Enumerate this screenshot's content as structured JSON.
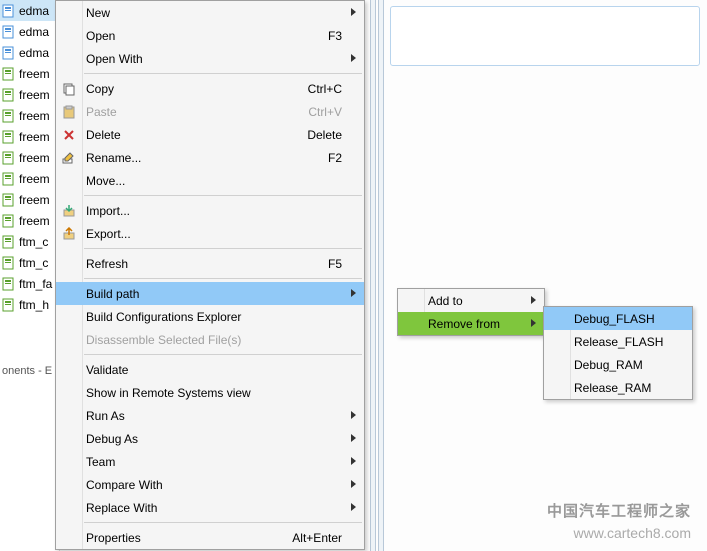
{
  "tree": {
    "items": [
      {
        "label": "edma",
        "icon": "file-blue",
        "selected": true
      },
      {
        "label": "edma",
        "icon": "file-blue"
      },
      {
        "label": "edma",
        "icon": "file-blue"
      },
      {
        "label": "freem",
        "icon": "file-green"
      },
      {
        "label": "freem",
        "icon": "file-green"
      },
      {
        "label": "freem",
        "icon": "file-green"
      },
      {
        "label": "freem",
        "icon": "file-green"
      },
      {
        "label": "freem",
        "icon": "file-green"
      },
      {
        "label": "freem",
        "icon": "file-green"
      },
      {
        "label": "freem",
        "icon": "file-green"
      },
      {
        "label": "freem",
        "icon": "file-green"
      },
      {
        "label": "ftm_c",
        "icon": "file-green"
      },
      {
        "label": "ftm_c",
        "icon": "file-green"
      },
      {
        "label": "ftm_fa",
        "icon": "file-green"
      },
      {
        "label": "ftm_h",
        "icon": "file-green"
      }
    ]
  },
  "bottom_panel": "onents - E",
  "menu1": {
    "groups": [
      [
        {
          "label": "New",
          "submenu": true
        },
        {
          "label": "Open",
          "shortcut": "F3"
        },
        {
          "label": "Open With",
          "submenu": true
        }
      ],
      [
        {
          "label": "Copy",
          "shortcut": "Ctrl+C",
          "icon": "copy"
        },
        {
          "label": "Paste",
          "shortcut": "Ctrl+V",
          "icon": "paste",
          "disabled": true
        },
        {
          "label": "Delete",
          "shortcut": "Delete",
          "icon": "delete"
        },
        {
          "label": "Rename...",
          "shortcut": "F2",
          "icon": "rename"
        },
        {
          "label": "Move..."
        }
      ],
      [
        {
          "label": "Import...",
          "icon": "import"
        },
        {
          "label": "Export...",
          "icon": "export"
        }
      ],
      [
        {
          "label": "Refresh",
          "shortcut": "F5"
        }
      ],
      [
        {
          "label": "Build path",
          "submenu": true,
          "hover": true
        },
        {
          "label": "Build Configurations Explorer"
        },
        {
          "label": "Disassemble Selected File(s)",
          "disabled": true
        }
      ],
      [
        {
          "label": "Validate"
        },
        {
          "label": "Show in Remote Systems view"
        },
        {
          "label": "Run As",
          "submenu": true
        },
        {
          "label": "Debug As",
          "submenu": true
        },
        {
          "label": "Team",
          "submenu": true
        },
        {
          "label": "Compare With",
          "submenu": true
        },
        {
          "label": "Replace With",
          "submenu": true
        }
      ],
      [
        {
          "label": "Properties",
          "shortcut": "Alt+Enter"
        }
      ]
    ]
  },
  "menu2": {
    "items": [
      {
        "label": "Add to",
        "submenu": true
      },
      {
        "label": "Remove from",
        "submenu": true,
        "hover": true
      }
    ]
  },
  "menu3": {
    "items": [
      {
        "label": "Debug_FLASH",
        "hover": true
      },
      {
        "label": "Release_FLASH"
      },
      {
        "label": "Debug_RAM"
      },
      {
        "label": "Release_RAM"
      }
    ]
  },
  "watermark": {
    "line1": "中国汽车工程师之家",
    "line2": "www.cartech8.com"
  }
}
